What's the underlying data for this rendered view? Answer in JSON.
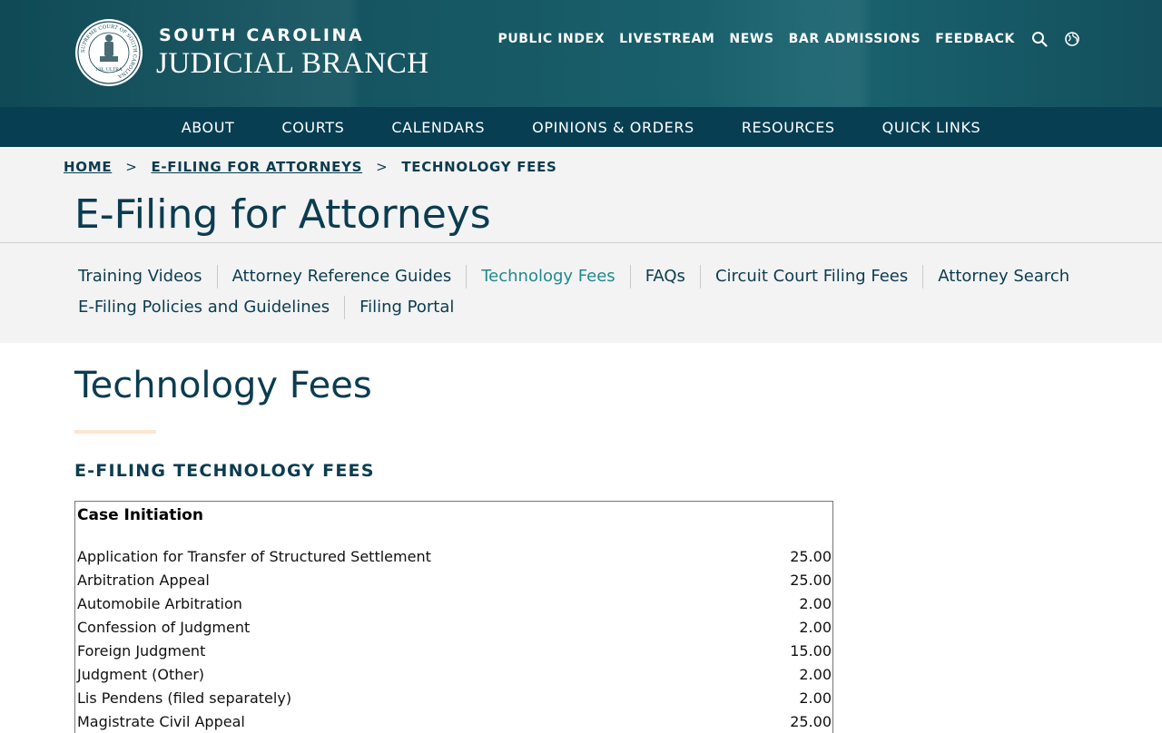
{
  "header": {
    "brand_top": "SOUTH CAROLINA",
    "brand_bottom": "JUDICIAL BRANCH",
    "seal_outer": "SUPREME COURT OF SOUTH CAROLINA",
    "seal_motto": "NIL ULTRA",
    "util_links": [
      "PUBLIC INDEX",
      "LIVESTREAM",
      "NEWS",
      "BAR ADMISSIONS",
      "FEEDBACK"
    ],
    "icons": [
      "search-icon",
      "globe-icon"
    ]
  },
  "main_nav": [
    "ABOUT",
    "COURTS",
    "CALENDARS",
    "OPINIONS & ORDERS",
    "RESOURCES",
    "QUICK LINKS"
  ],
  "breadcrumb": {
    "home": "HOME",
    "section": "E-FILING FOR ATTORNEYS",
    "current": "TECHNOLOGY FEES",
    "separator": ">"
  },
  "section_title": "E-Filing for Attorneys",
  "subnav": {
    "row1": [
      "Training Videos",
      "Attorney Reference Guides",
      "Technology Fees",
      "FAQs",
      "Circuit Court Filing Fees",
      "Attorney Search"
    ],
    "row2": [
      "E-Filing Policies and Guidelines",
      "Filing Portal"
    ],
    "active": "Technology Fees"
  },
  "page_title": "Technology Fees",
  "fees_heading": "E-FILING TECHNOLOGY FEES",
  "fee_table": {
    "caption": "Case Initiation",
    "rows": [
      {
        "item": "Application for Transfer of Structured Settlement",
        "fee": "25.00"
      },
      {
        "item": "Arbitration Appeal",
        "fee": "25.00"
      },
      {
        "item": "Automobile Arbitration",
        "fee": "2.00"
      },
      {
        "item": "Confession of Judgment",
        "fee": "2.00"
      },
      {
        "item": "Foreign Judgment",
        "fee": "15.00"
      },
      {
        "item": "Judgment (Other)",
        "fee": "2.00"
      },
      {
        "item": "Lis Pendens (filed separately)",
        "fee": "2.00"
      },
      {
        "item": "Magistrate Civil Appeal",
        "fee": "25.00"
      }
    ]
  },
  "colors": {
    "header_bg": "#175a66",
    "nav_bg": "#073e52",
    "title_text": "#0b3c50",
    "active_link": "#1f8a8e",
    "accent_bar": "#fbe7cf"
  }
}
